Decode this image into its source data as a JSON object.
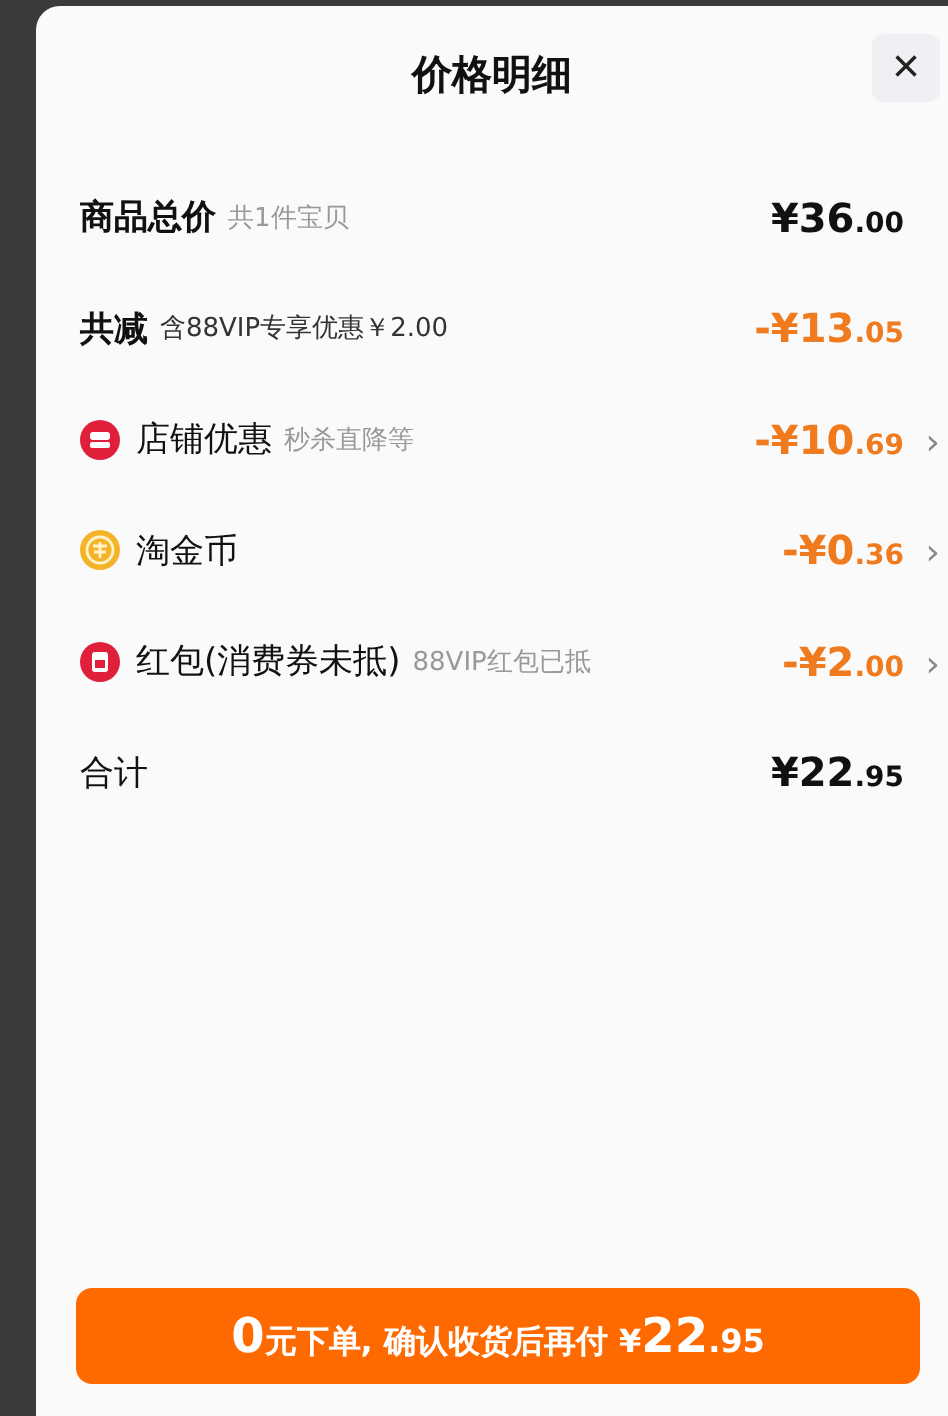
{
  "sheet": {
    "title": "价格明细",
    "close": "×"
  },
  "rows": [
    {
      "kind": "summary",
      "label": "商品总价",
      "note": "共1件宝贝",
      "amount": "¥36",
      "cents": ".00",
      "expandable": false
    },
    {
      "kind": "saving",
      "label": "共减",
      "note": "含88VIP专享优惠￥2.00",
      "amount": "-¥13",
      "cents": ".05",
      "expandable": false
    },
    {
      "kind": "shop",
      "label": "店铺优惠",
      "note": "秒杀直降等",
      "amount": "-¥10",
      "cents": ".69",
      "expandable": true
    },
    {
      "kind": "coin",
      "label": "淘金币",
      "amount": "-¥0",
      "cents": ".36",
      "expandable": true
    },
    {
      "kind": "packet",
      "label": "红包(消费券未抵)",
      "note": "88VIP红包已抵",
      "amount": "-¥2",
      "cents": ".00",
      "expandable": true
    },
    {
      "kind": "total",
      "label": "合计",
      "amount": "¥22",
      "cents": ".95",
      "expandable": false
    }
  ],
  "chevron": "›",
  "button": {
    "parts": [
      {
        "text": "0",
        "emphasis": true
      },
      {
        "text": "元下单, 确认收货后再付 ¥",
        "emphasis": false
      },
      {
        "text": "22",
        "emphasis": true
      },
      {
        "text": ".95",
        "emphasis": false
      }
    ]
  }
}
